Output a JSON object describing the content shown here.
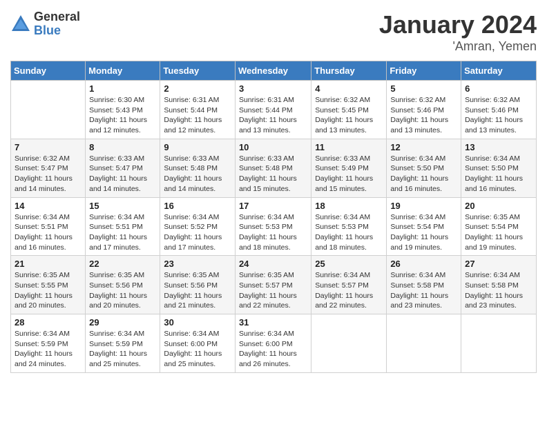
{
  "header": {
    "logo_general": "General",
    "logo_blue": "Blue",
    "month": "January 2024",
    "location": "'Amran, Yemen"
  },
  "days_of_week": [
    "Sunday",
    "Monday",
    "Tuesday",
    "Wednesday",
    "Thursday",
    "Friday",
    "Saturday"
  ],
  "weeks": [
    [
      {
        "day": "",
        "info": ""
      },
      {
        "day": "1",
        "info": "Sunrise: 6:30 AM\nSunset: 5:43 PM\nDaylight: 11 hours\nand 12 minutes."
      },
      {
        "day": "2",
        "info": "Sunrise: 6:31 AM\nSunset: 5:44 PM\nDaylight: 11 hours\nand 12 minutes."
      },
      {
        "day": "3",
        "info": "Sunrise: 6:31 AM\nSunset: 5:44 PM\nDaylight: 11 hours\nand 13 minutes."
      },
      {
        "day": "4",
        "info": "Sunrise: 6:32 AM\nSunset: 5:45 PM\nDaylight: 11 hours\nand 13 minutes."
      },
      {
        "day": "5",
        "info": "Sunrise: 6:32 AM\nSunset: 5:46 PM\nDaylight: 11 hours\nand 13 minutes."
      },
      {
        "day": "6",
        "info": "Sunrise: 6:32 AM\nSunset: 5:46 PM\nDaylight: 11 hours\nand 13 minutes."
      }
    ],
    [
      {
        "day": "7",
        "info": "Sunrise: 6:32 AM\nSunset: 5:47 PM\nDaylight: 11 hours\nand 14 minutes."
      },
      {
        "day": "8",
        "info": "Sunrise: 6:33 AM\nSunset: 5:47 PM\nDaylight: 11 hours\nand 14 minutes."
      },
      {
        "day": "9",
        "info": "Sunrise: 6:33 AM\nSunset: 5:48 PM\nDaylight: 11 hours\nand 14 minutes."
      },
      {
        "day": "10",
        "info": "Sunrise: 6:33 AM\nSunset: 5:48 PM\nDaylight: 11 hours\nand 15 minutes."
      },
      {
        "day": "11",
        "info": "Sunrise: 6:33 AM\nSunset: 5:49 PM\nDaylight: 11 hours\nand 15 minutes."
      },
      {
        "day": "12",
        "info": "Sunrise: 6:34 AM\nSunset: 5:50 PM\nDaylight: 11 hours\nand 16 minutes."
      },
      {
        "day": "13",
        "info": "Sunrise: 6:34 AM\nSunset: 5:50 PM\nDaylight: 11 hours\nand 16 minutes."
      }
    ],
    [
      {
        "day": "14",
        "info": "Sunrise: 6:34 AM\nSunset: 5:51 PM\nDaylight: 11 hours\nand 16 minutes."
      },
      {
        "day": "15",
        "info": "Sunrise: 6:34 AM\nSunset: 5:51 PM\nDaylight: 11 hours\nand 17 minutes."
      },
      {
        "day": "16",
        "info": "Sunrise: 6:34 AM\nSunset: 5:52 PM\nDaylight: 11 hours\nand 17 minutes."
      },
      {
        "day": "17",
        "info": "Sunrise: 6:34 AM\nSunset: 5:53 PM\nDaylight: 11 hours\nand 18 minutes."
      },
      {
        "day": "18",
        "info": "Sunrise: 6:34 AM\nSunset: 5:53 PM\nDaylight: 11 hours\nand 18 minutes."
      },
      {
        "day": "19",
        "info": "Sunrise: 6:34 AM\nSunset: 5:54 PM\nDaylight: 11 hours\nand 19 minutes."
      },
      {
        "day": "20",
        "info": "Sunrise: 6:35 AM\nSunset: 5:54 PM\nDaylight: 11 hours\nand 19 minutes."
      }
    ],
    [
      {
        "day": "21",
        "info": "Sunrise: 6:35 AM\nSunset: 5:55 PM\nDaylight: 11 hours\nand 20 minutes."
      },
      {
        "day": "22",
        "info": "Sunrise: 6:35 AM\nSunset: 5:56 PM\nDaylight: 11 hours\nand 20 minutes."
      },
      {
        "day": "23",
        "info": "Sunrise: 6:35 AM\nSunset: 5:56 PM\nDaylight: 11 hours\nand 21 minutes."
      },
      {
        "day": "24",
        "info": "Sunrise: 6:35 AM\nSunset: 5:57 PM\nDaylight: 11 hours\nand 22 minutes."
      },
      {
        "day": "25",
        "info": "Sunrise: 6:34 AM\nSunset: 5:57 PM\nDaylight: 11 hours\nand 22 minutes."
      },
      {
        "day": "26",
        "info": "Sunrise: 6:34 AM\nSunset: 5:58 PM\nDaylight: 11 hours\nand 23 minutes."
      },
      {
        "day": "27",
        "info": "Sunrise: 6:34 AM\nSunset: 5:58 PM\nDaylight: 11 hours\nand 23 minutes."
      }
    ],
    [
      {
        "day": "28",
        "info": "Sunrise: 6:34 AM\nSunset: 5:59 PM\nDaylight: 11 hours\nand 24 minutes."
      },
      {
        "day": "29",
        "info": "Sunrise: 6:34 AM\nSunset: 5:59 PM\nDaylight: 11 hours\nand 25 minutes."
      },
      {
        "day": "30",
        "info": "Sunrise: 6:34 AM\nSunset: 6:00 PM\nDaylight: 11 hours\nand 25 minutes."
      },
      {
        "day": "31",
        "info": "Sunrise: 6:34 AM\nSunset: 6:00 PM\nDaylight: 11 hours\nand 26 minutes."
      },
      {
        "day": "",
        "info": ""
      },
      {
        "day": "",
        "info": ""
      },
      {
        "day": "",
        "info": ""
      }
    ]
  ]
}
